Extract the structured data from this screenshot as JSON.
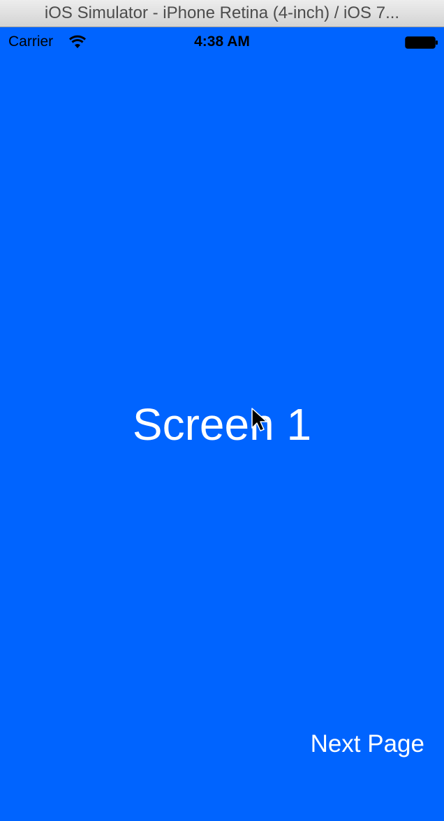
{
  "window": {
    "title": "iOS Simulator - iPhone Retina (4-inch) / iOS 7..."
  },
  "status_bar": {
    "carrier": "Carrier",
    "time": "4:38 AM",
    "wifi_icon": "wifi-icon",
    "battery_icon": "battery-icon"
  },
  "main": {
    "title": "Screen 1",
    "background_color": "#0064FF"
  },
  "footer": {
    "next_button_label": "Next Page"
  },
  "cursor": {
    "icon": "mouse-pointer-icon"
  }
}
